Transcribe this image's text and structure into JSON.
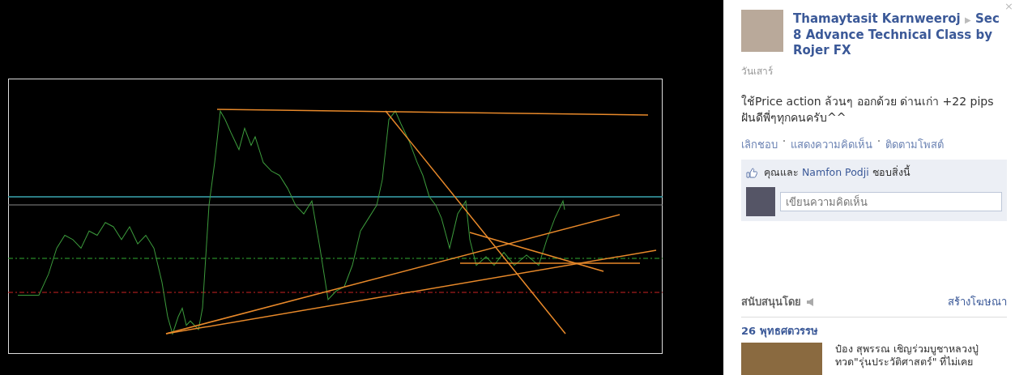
{
  "viewer": {
    "close": "×"
  },
  "post": {
    "author": "Thamaytasit Karnweeroj",
    "separator": "▶",
    "target": "Sec 8 Advance Technical Class by Rojer FX",
    "date": "วันเสาร์",
    "text": "ใช้Price action ล้วนๆ ออกด้วย ด่านเก่า +22 pips ฝันดีพี่ๆทุกคนครับ^^",
    "actions": [
      {
        "label": "เลิกชอบ"
      },
      {
        "label": "แสดงความคิดเห็น"
      },
      {
        "label": "ติดตามโพสต์"
      }
    ],
    "likes": {
      "prefix": "คุณและ",
      "name": "Namfon Podji",
      "suffix": "ชอบสิ่งนี้"
    },
    "comment": {
      "placeholder": "เขียนความคิดเห็น"
    }
  },
  "sponsored": {
    "title": "สนับสนุนโดย",
    "create": "สร้างโฆษณา",
    "ad": {
      "title": "26 พุทธศตวรรษ",
      "lines": [
        "ป๋อง สุพรรณ เชิญร่วมบูชาหลวงปู่",
        "ทวด\"รุ่นประวัติศาสตร์\" ที่ไม่เคย"
      ]
    }
  }
}
